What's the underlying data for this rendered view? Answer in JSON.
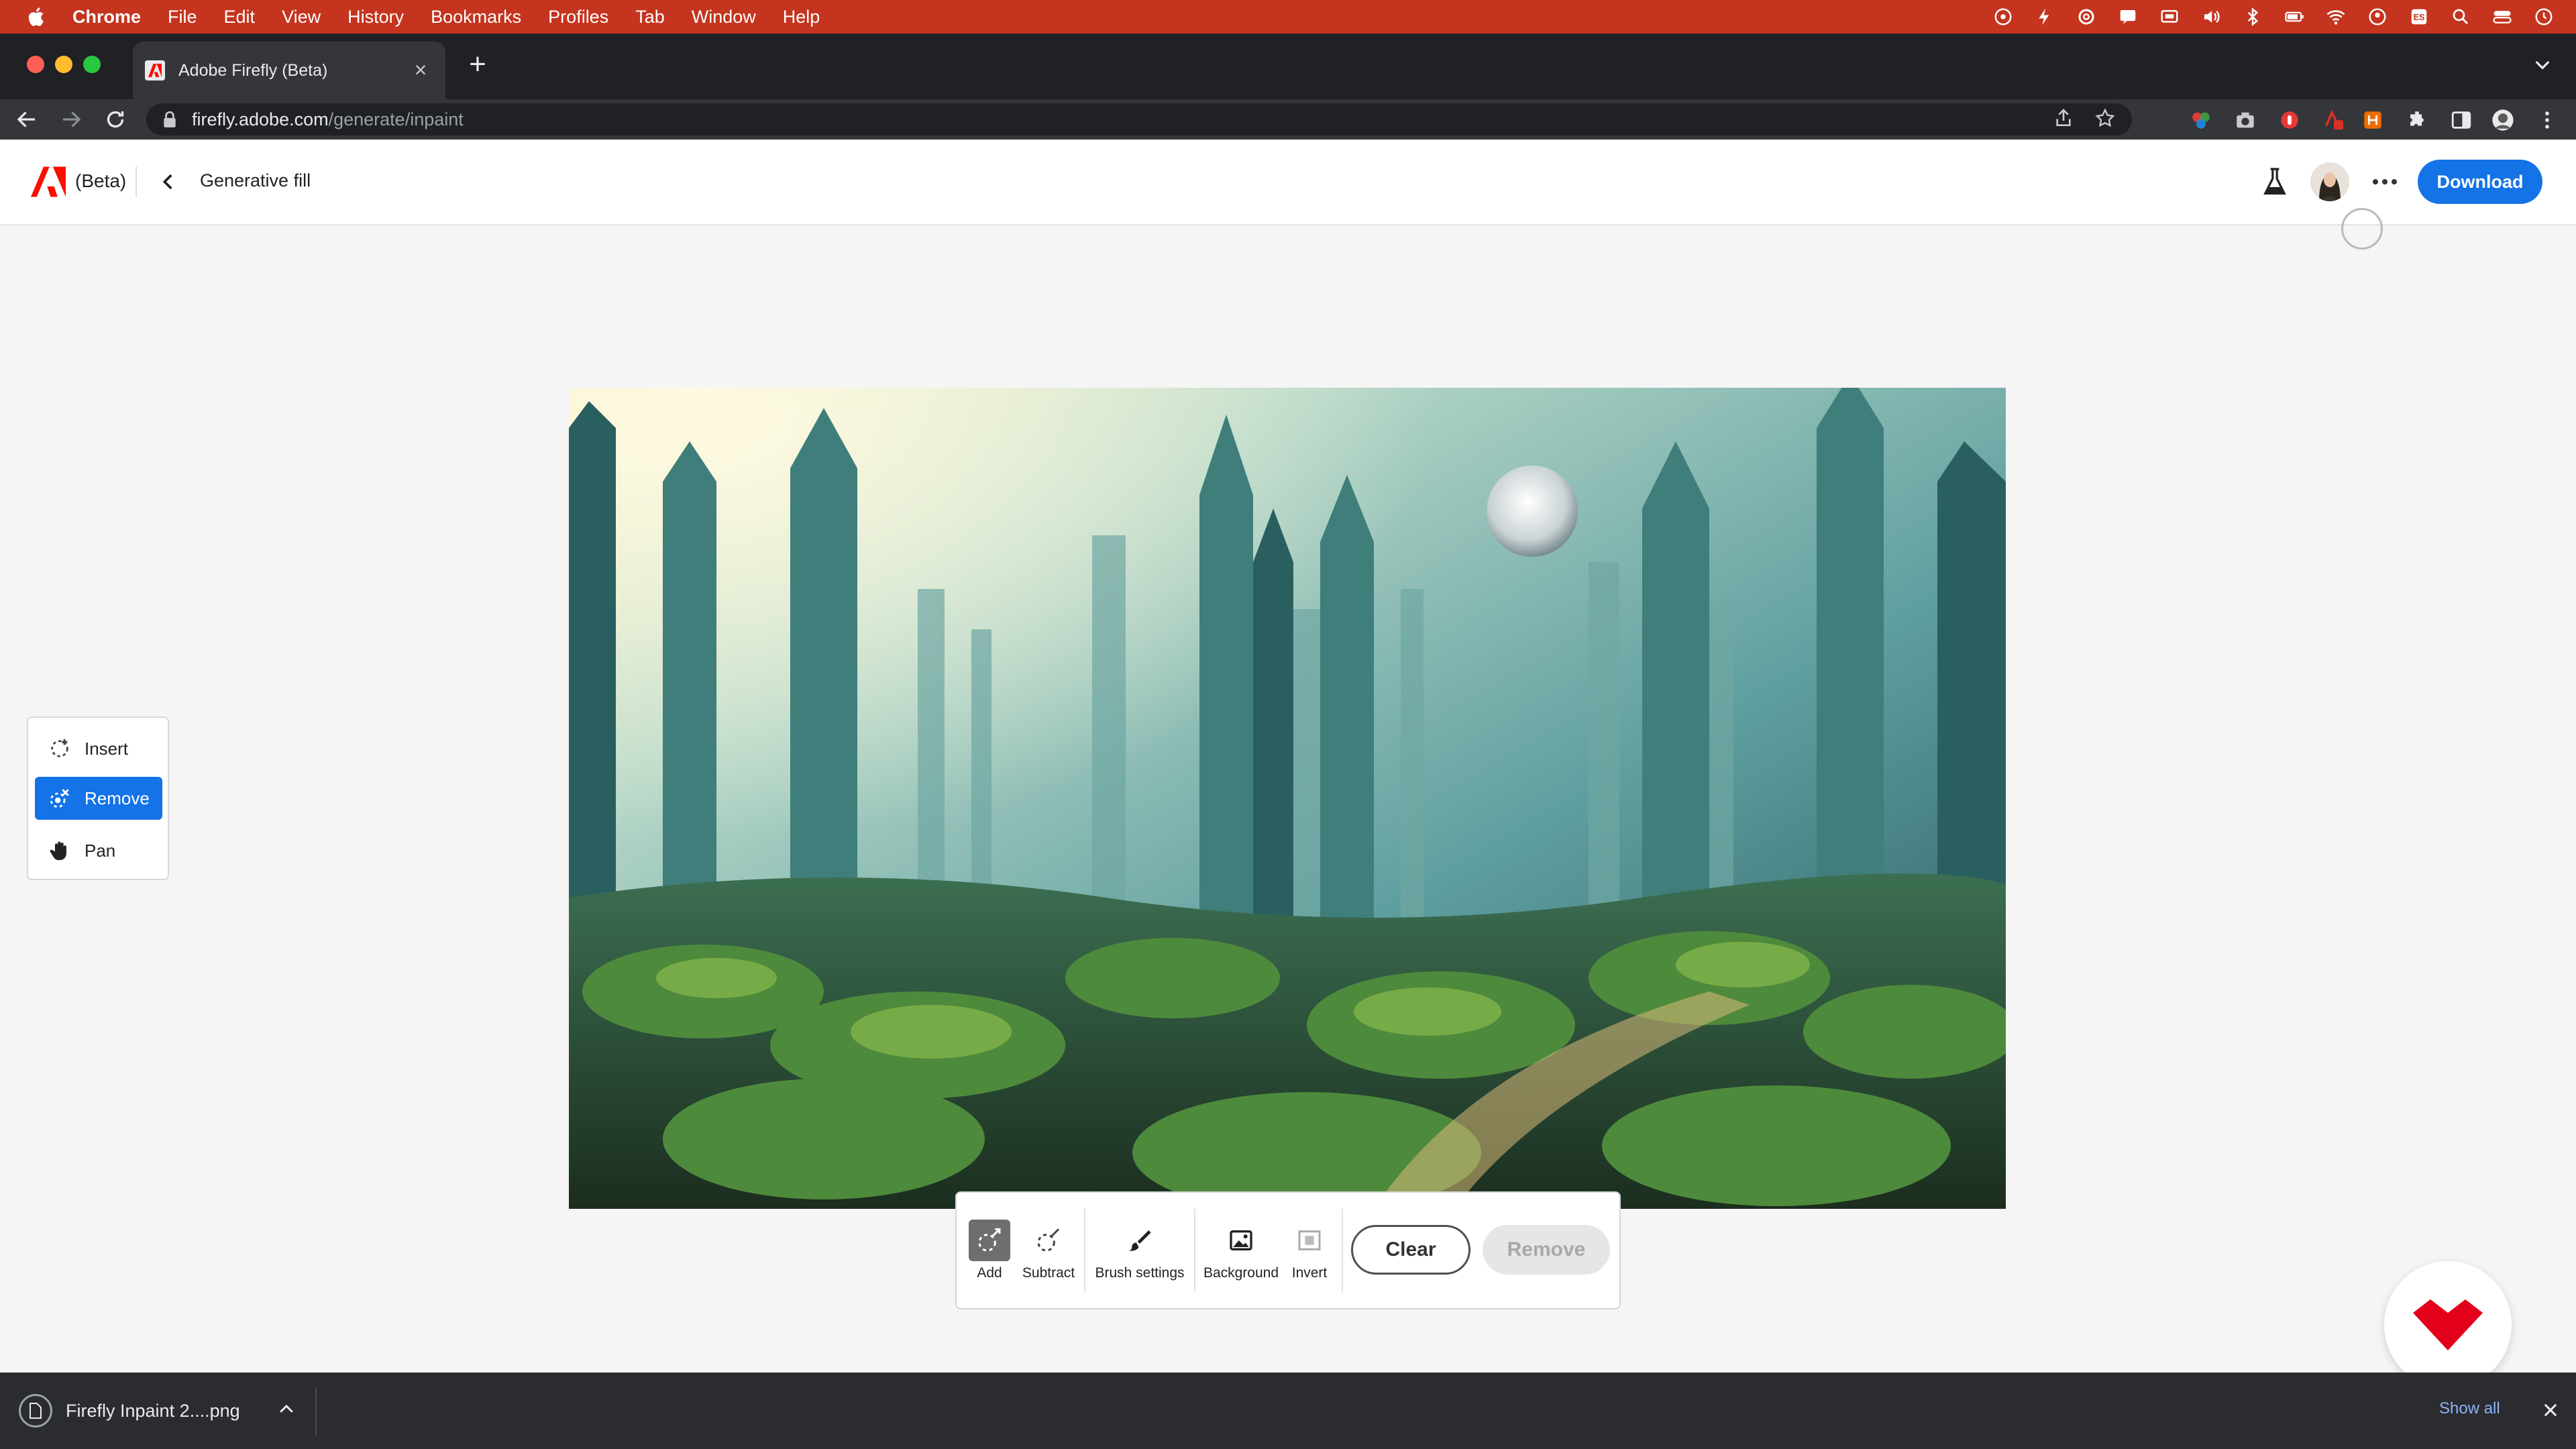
{
  "menubar": {
    "app": "Chrome",
    "items": [
      "File",
      "Edit",
      "View",
      "History",
      "Bookmarks",
      "Profiles",
      "Tab",
      "Window",
      "Help"
    ],
    "status_icons": [
      "creative-cloud-icon",
      "lightning-icon",
      "sync-icon",
      "notification-icon",
      "cast-icon",
      "volume-icon",
      "bluetooth-icon",
      "battery-icon",
      "wifi-icon",
      "user-icon",
      "keyboard-icon",
      "search-icon",
      "control-center-icon",
      "clock-icon"
    ],
    "keyboard_label": "ES"
  },
  "browser": {
    "tab_title": "Adobe Firefly (Beta)",
    "url_host": "firefly.adobe.com",
    "url_path": "/generate/inpaint"
  },
  "app": {
    "beta_label": "(Beta)",
    "page_title": "Generative fill",
    "download_label": "Download",
    "accent": "#1473e6",
    "brand_red": "#fa0f00"
  },
  "tools": [
    {
      "label": "Insert",
      "icon": "insert-icon",
      "active": false
    },
    {
      "label": "Remove",
      "icon": "remove-icon",
      "active": true
    },
    {
      "label": "Pan",
      "icon": "hand-icon",
      "active": false
    }
  ],
  "brushbar": {
    "add": "Add",
    "subtract": "Subtract",
    "brush_settings": "Brush settings",
    "background": "Background",
    "invert": "Invert",
    "clear": "Clear",
    "remove": "Remove"
  },
  "downloads": {
    "file": "Firefly Inpaint 2....png",
    "show_all": "Show all"
  }
}
